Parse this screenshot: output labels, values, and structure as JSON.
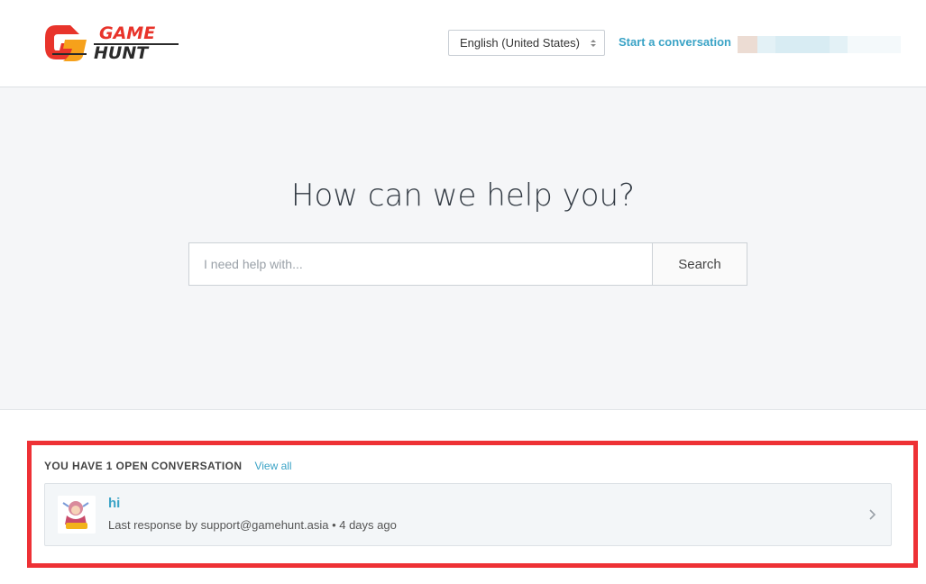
{
  "header": {
    "logo_text_line1": "GAME",
    "logo_text_line2": "HUNT",
    "language": "English (United States)",
    "start_conversation": "Start a conversation"
  },
  "hero": {
    "title": "How can we help you?",
    "search_placeholder": "I need help with...",
    "search_button": "Search"
  },
  "conversations": {
    "heading": "YOU HAVE 1 OPEN CONVERSATION",
    "view_all": "View all",
    "items": [
      {
        "title": "hi",
        "meta": "Last response by support@gamehunt.asia • 4 days ago"
      }
    ]
  },
  "colors": {
    "accent": "#3aa3c6",
    "highlight_border": "#ee3135",
    "hero_bg": "#f5f6f8"
  }
}
